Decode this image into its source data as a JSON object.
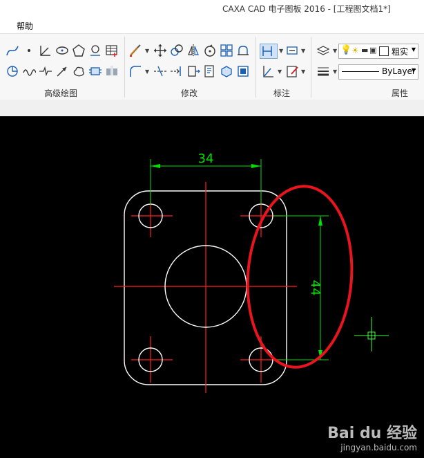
{
  "window": {
    "title": "CAXA CAD 电子图板 2016 - [工程图文档1*]"
  },
  "menu": {
    "help": "帮助"
  },
  "ribbon": {
    "groups": {
      "advanced_draw": "高级绘图",
      "modify": "修改",
      "annotate": "标注",
      "properties": "属性"
    },
    "line_weight_label": "粗实",
    "line_type_label": "ByLayer"
  },
  "drawing": {
    "dim_horizontal": "34",
    "dim_vertical": "44",
    "colors": {
      "outline": "#ffffff",
      "center": "#ff2020",
      "dimension": "#00e000",
      "highlight": "#e8141e",
      "cursor": "#40ff40"
    }
  },
  "watermark": {
    "brand": "Bai du 经验",
    "url": "jingyan.baidu.com"
  }
}
